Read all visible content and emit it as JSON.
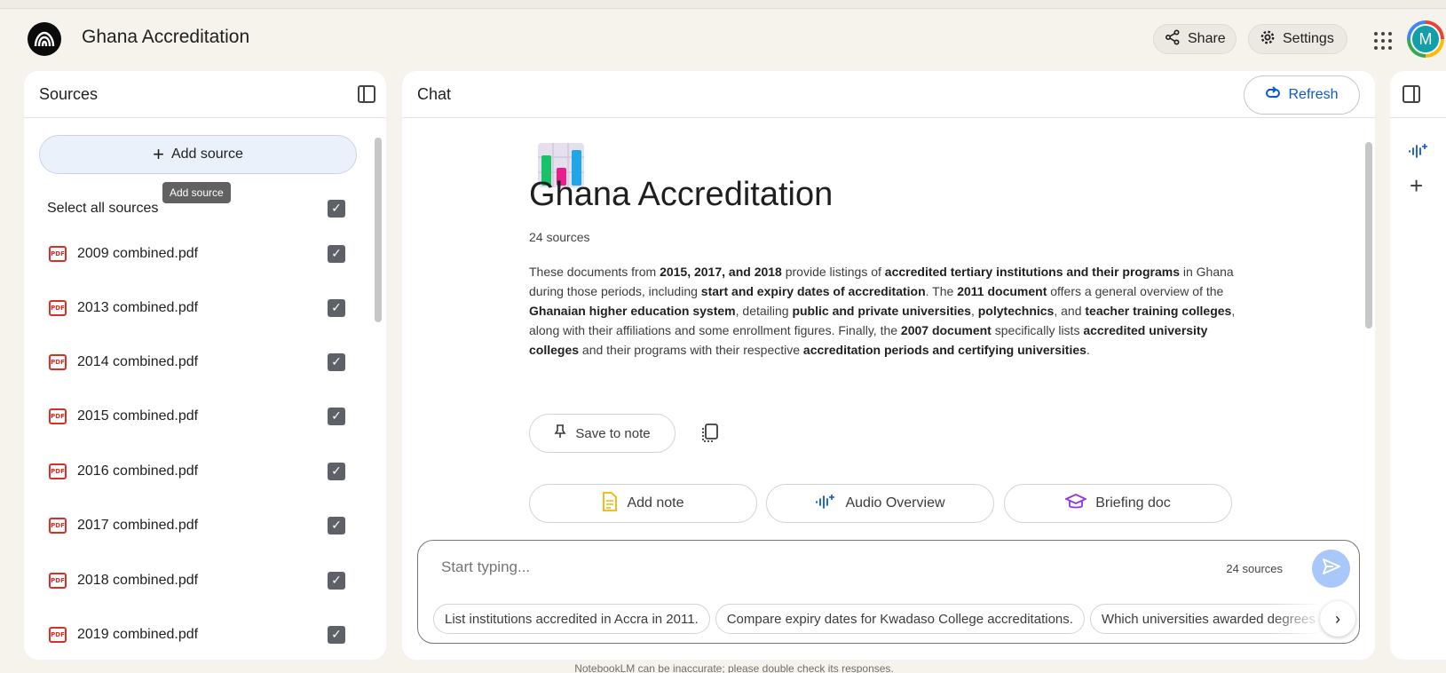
{
  "header": {
    "title": "Ghana Accreditation",
    "share_label": "Share",
    "settings_label": "Settings",
    "avatar_letter": "M"
  },
  "sources": {
    "title": "Sources",
    "add_source_label": "Add source",
    "tooltip": "Add source",
    "select_all_label": "Select all sources",
    "items": [
      {
        "label": "2009 combined.pdf"
      },
      {
        "label": "2013 combined.pdf"
      },
      {
        "label": "2014 combined.pdf"
      },
      {
        "label": "2015 combined.pdf"
      },
      {
        "label": "2016 combined.pdf"
      },
      {
        "label": "2017 combined.pdf"
      },
      {
        "label": "2018 combined.pdf"
      },
      {
        "label": "2019 combined.pdf"
      }
    ]
  },
  "chat": {
    "title": "Chat",
    "refresh_label": "Refresh",
    "notebook_title": "Ghana Accreditation",
    "source_count": "24 sources",
    "save_note_label": "Save to note",
    "actions": {
      "add_note": "Add note",
      "audio_overview": "Audio Overview",
      "briefing_doc": "Briefing doc"
    },
    "composer": {
      "placeholder": "Start typing...",
      "source_count": "24 sources"
    },
    "suggestions": [
      "List institutions accredited in Accra in 2011.",
      "Compare expiry dates for Kwadaso College accreditations.",
      "Which universities awarded degrees"
    ]
  },
  "summary": {
    "parts": [
      "These documents from ",
      "2015, 2017, and 2018",
      " provide listings of ",
      "accredited tertiary institutions and their programs",
      " in Ghana during those periods, including ",
      "start and expiry dates of accreditation",
      ". The ",
      "2011 document",
      " offers a general overview of the ",
      "Ghanaian higher education system",
      ", detailing ",
      "public and private universities",
      ", ",
      "polytechnics",
      ", and ",
      "teacher training colleges",
      ", along with their affiliations and some enrollment figures. Finally, the ",
      "2007 document",
      " specifically lists ",
      "accredited university colleges",
      " and their programs with their respective ",
      "accreditation periods and certifying universities",
      "."
    ]
  },
  "footer": {
    "note": "NotebookLM can be inaccurate; please double check its responses."
  },
  "colors": {
    "accent": "#0b57d0",
    "background": "#f6f2ec",
    "checkbox": "#5e6168",
    "pdf_icon": "#d93025"
  },
  "icons": {
    "logo": "notebooklm-logo-icon",
    "share": "share-icon",
    "settings": "gear-icon",
    "apps": "apps-grid-icon",
    "panel": "panel-toggle-icon",
    "pdf": "pdf-icon",
    "check": "checkbox-checked-icon",
    "refresh": "refresh-icon",
    "pin": "pin-icon",
    "copy": "copy-icon",
    "note": "note-icon",
    "audio": "audio-waveform-icon",
    "briefing": "graduation-cap-icon",
    "send": "send-icon",
    "next": "chevron-right-icon",
    "plus": "plus-icon"
  }
}
